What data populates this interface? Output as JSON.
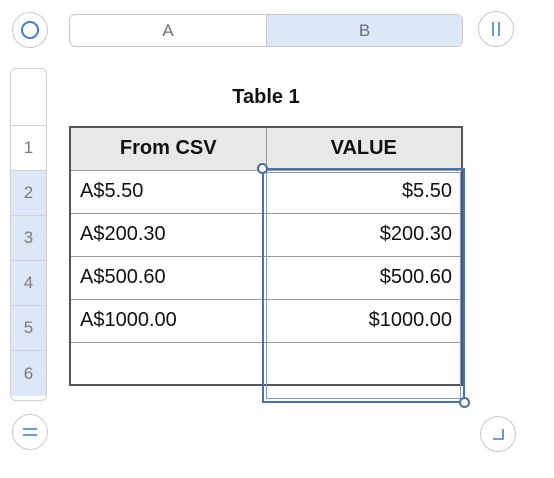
{
  "table": {
    "title": "Table 1",
    "columns": [
      "A",
      "B"
    ],
    "row_numbers": [
      "1",
      "2",
      "3",
      "4",
      "5",
      "6"
    ],
    "header": [
      "From CSV",
      "VALUE"
    ],
    "rows": [
      [
        "A$5.50",
        "$5.50"
      ],
      [
        "A$200.30",
        "$200.30"
      ],
      [
        "A$500.60",
        "$500.60"
      ],
      [
        "A$1000.00",
        "$1000.00"
      ],
      [
        "",
        ""
      ]
    ]
  },
  "selection": {
    "selected_column": "B",
    "selected_rows": [
      "2",
      "3",
      "4",
      "5",
      "6"
    ]
  },
  "colors": {
    "selection": "#4a72ad",
    "selected_header": "#dce8f7",
    "header_row": "#e8e8e8"
  }
}
